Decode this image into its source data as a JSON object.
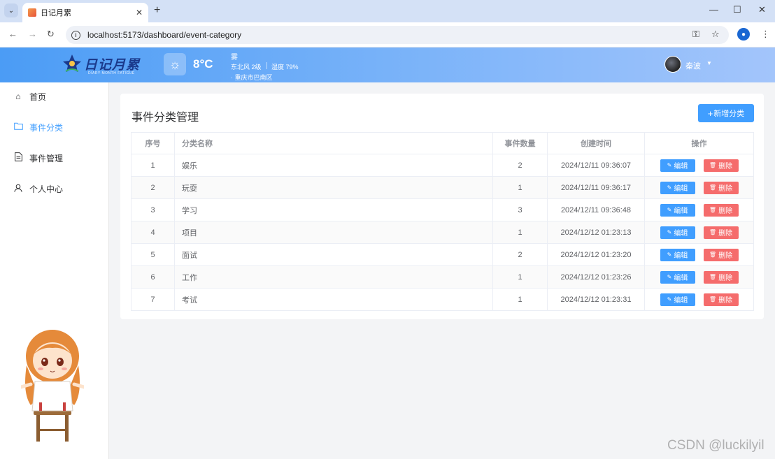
{
  "browser": {
    "tab_title": "日记月累",
    "url": "localhost:5173/dashboard/event-category"
  },
  "header": {
    "logo_text": "日记月累",
    "logo_sub": "DIARY MONTH FATIGUE",
    "temperature": "8°C",
    "condition": "雾",
    "wind": "东北风 2级",
    "humidity": "湿度 79%",
    "location": "· 重庆市巴南区",
    "username": "秦波"
  },
  "sidebar": {
    "items": [
      {
        "label": "首页",
        "icon": "home-icon"
      },
      {
        "label": "事件分类",
        "icon": "folder-icon",
        "active": true
      },
      {
        "label": "事件管理",
        "icon": "document-icon"
      },
      {
        "label": "个人中心",
        "icon": "user-icon"
      }
    ]
  },
  "main": {
    "title": "事件分类管理",
    "add_button": "新增分类",
    "columns": {
      "index": "序号",
      "name": "分类名称",
      "count": "事件数量",
      "created": "创建时间",
      "ops": "操作"
    },
    "edit_label": "编辑",
    "delete_label": "删除",
    "rows": [
      {
        "index": "1",
        "name": "娱乐",
        "count": "2",
        "created": "2024/12/11 09:36:07"
      },
      {
        "index": "2",
        "name": "玩耍",
        "count": "1",
        "created": "2024/12/11 09:36:17"
      },
      {
        "index": "3",
        "name": "学习",
        "count": "3",
        "created": "2024/12/11 09:36:48"
      },
      {
        "index": "4",
        "name": "项目",
        "count": "1",
        "created": "2024/12/12 01:23:13"
      },
      {
        "index": "5",
        "name": "面试",
        "count": "2",
        "created": "2024/12/12 01:23:20"
      },
      {
        "index": "6",
        "name": "工作",
        "count": "1",
        "created": "2024/12/12 01:23:26"
      },
      {
        "index": "7",
        "name": "考试",
        "count": "1",
        "created": "2024/12/12 01:23:31"
      }
    ]
  },
  "watermark": "CSDN @luckilyil",
  "colors": {
    "primary": "#409eff",
    "danger": "#f56c6c",
    "header_start": "#4b9cf5",
    "header_end": "#a3c5fb"
  }
}
